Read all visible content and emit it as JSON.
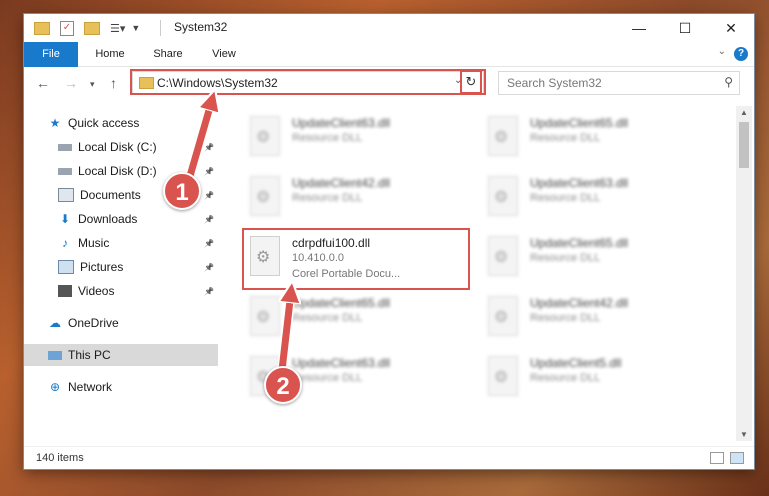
{
  "window": {
    "title": "System32",
    "minimize": "—",
    "maximize": "☐",
    "close": "✕"
  },
  "ribbon": {
    "tabs": [
      "File",
      "Home",
      "Share",
      "View"
    ],
    "help": "?"
  },
  "navbar": {
    "address": "C:\\Windows\\System32",
    "search_placeholder": "Search System32"
  },
  "sidebar": {
    "items": [
      {
        "label": "Quick access",
        "icon": "star-icon"
      },
      {
        "label": "Local Disk (C:)",
        "icon": "drive-icon",
        "pinned": true
      },
      {
        "label": "Local Disk (D:)",
        "icon": "drive-icon",
        "pinned": true
      },
      {
        "label": "Documents",
        "icon": "documents-icon",
        "pinned": true
      },
      {
        "label": "Downloads",
        "icon": "downloads-icon",
        "pinned": true
      },
      {
        "label": "Music",
        "icon": "music-icon",
        "pinned": true
      },
      {
        "label": "Pictures",
        "icon": "pictures-icon",
        "pinned": true
      },
      {
        "label": "Videos",
        "icon": "videos-icon",
        "pinned": true
      },
      {
        "label": "OneDrive",
        "icon": "cloud-icon"
      },
      {
        "label": "This PC",
        "icon": "computer-icon",
        "selected": true
      },
      {
        "label": "Network",
        "icon": "network-icon"
      }
    ]
  },
  "files": [
    {
      "name": "UpdateClient63.dll",
      "type": "Resource DLL"
    },
    {
      "name": "UpdateClient65.dll",
      "type": "Resource DLL"
    },
    {
      "name": "UpdateClient42.dll",
      "type": "Resource DLL"
    },
    {
      "name": "UpdateClient63.dll",
      "type": "Resource DLL"
    },
    {
      "name": "cdrpdfui100.dll",
      "version": "10.410.0.0",
      "type": "Corel Portable Docu..."
    },
    {
      "name": "UpdateClient65.dll",
      "type": "Resource DLL"
    },
    {
      "name": "UpdateClient65.dll",
      "type": "Resource DLL"
    },
    {
      "name": "UpdateClient42.dll",
      "type": "Resource DLL"
    },
    {
      "name": "UpdateClient63.dll",
      "type": "Resource DLL"
    },
    {
      "name": "UpdateClient5.dll",
      "type": "Resource DLL"
    }
  ],
  "status": {
    "count": "140 items"
  },
  "annotations": {
    "step1": "1",
    "step2": "2"
  },
  "colors": {
    "accent": "#1979ca",
    "highlight": "#d9534f"
  }
}
